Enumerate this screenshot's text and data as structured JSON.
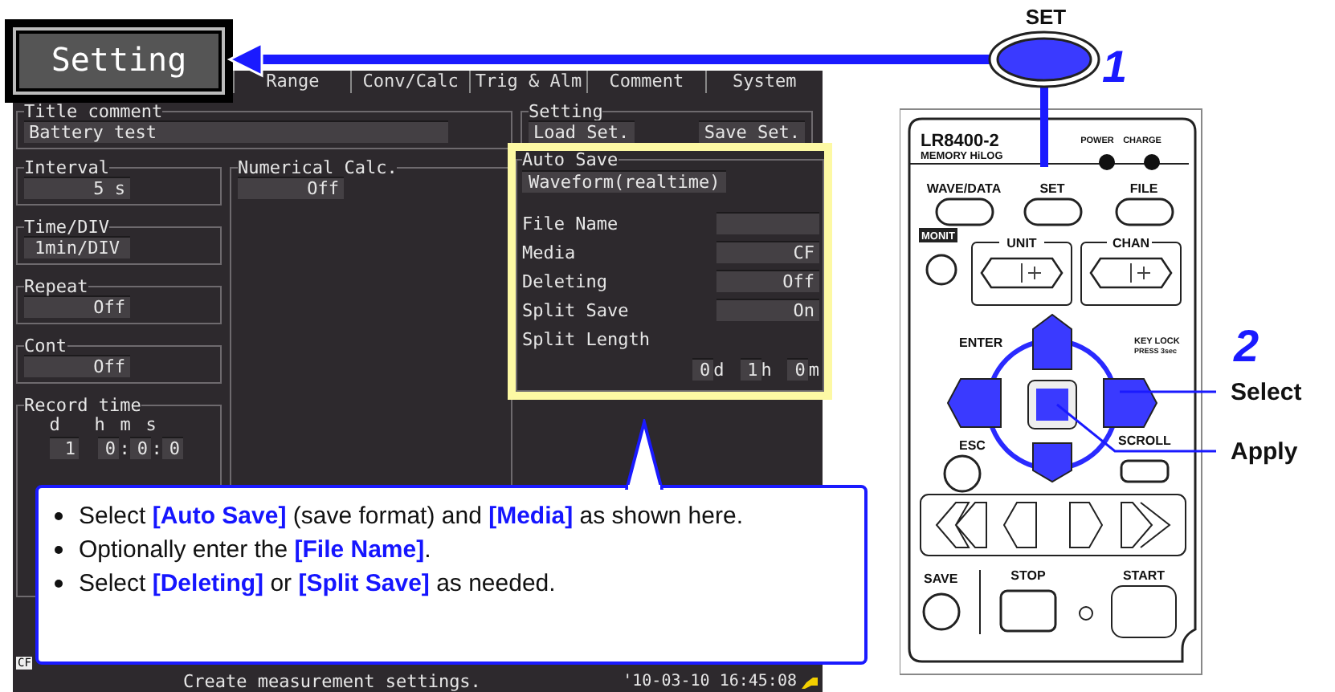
{
  "screen": {
    "tabs": [
      {
        "label": "Setting",
        "selected": true
      },
      {
        "label": "Range",
        "selected": false
      },
      {
        "label": "Conv/Calc",
        "selected": false
      },
      {
        "label": "Trig & Alm",
        "selected": false
      },
      {
        "label": "Comment",
        "selected": false
      },
      {
        "label": "System",
        "selected": false
      }
    ],
    "title_comment": {
      "label": "Title comment",
      "value": "Battery test"
    },
    "left_settings": [
      {
        "label": "Interval",
        "value": "5 s"
      },
      {
        "label": "Time/DIV",
        "value": "1min/DIV"
      },
      {
        "label": "Repeat",
        "value": "Off"
      },
      {
        "label": "Cont",
        "value": "Off"
      }
    ],
    "record_time": {
      "label": "Record time",
      "units": [
        "d",
        "h",
        "m",
        "s"
      ],
      "values": [
        "1",
        "0",
        "0",
        "0"
      ],
      "separator": ":"
    },
    "numerical_calc": {
      "label": "Numerical Calc.",
      "value": "Off"
    },
    "setting_group": {
      "label": "Setting",
      "buttons": [
        "Load Set.",
        "Save Set."
      ]
    },
    "auto_save": {
      "label": "Auto Save",
      "value": "Waveform(realtime)",
      "fields": [
        {
          "label": "File Name"
        },
        {
          "label": "Media",
          "value": "CF"
        },
        {
          "label": "Deleting",
          "value": "Off"
        },
        {
          "label": "Split Save",
          "value": "On"
        }
      ],
      "split_length": {
        "label": "Split Length",
        "parts": [
          {
            "value": "0",
            "unit": "d"
          },
          {
            "value": "1",
            "unit": "h"
          },
          {
            "value": "0",
            "unit": "m"
          }
        ]
      }
    },
    "media_icon": "CF",
    "status_message": "Create measurement settings.",
    "datetime": "'10-03-10 16:45:08"
  },
  "callout": {
    "bullets": [
      "Select **[Auto Save]** (save format) and **[Media]** as shown here.",
      "Optionally enter the **[File Name]**.",
      "Select **[Deleting]** or **[Split Save]** as needed."
    ]
  },
  "device_panel": {
    "model": "LR8400-2",
    "series": "MEMORY HiLOG",
    "indicators": [
      "POWER",
      "CHARGE"
    ],
    "top_keys": [
      "WAVE/DATA",
      "SET",
      "FILE"
    ],
    "monit": "MONIT",
    "knobs": [
      "UNIT",
      "CHAN"
    ],
    "enter": "ENTER",
    "key_lock": [
      "KEY LOCK",
      "PRESS 3sec"
    ],
    "esc": "ESC",
    "scroll": "SCROLL",
    "save": "SAVE",
    "stop": "STOP",
    "start": "START"
  },
  "steps": [
    {
      "number": "1",
      "key": "SET"
    },
    {
      "number": "2",
      "actions": [
        "Select",
        "Apply"
      ]
    }
  ]
}
